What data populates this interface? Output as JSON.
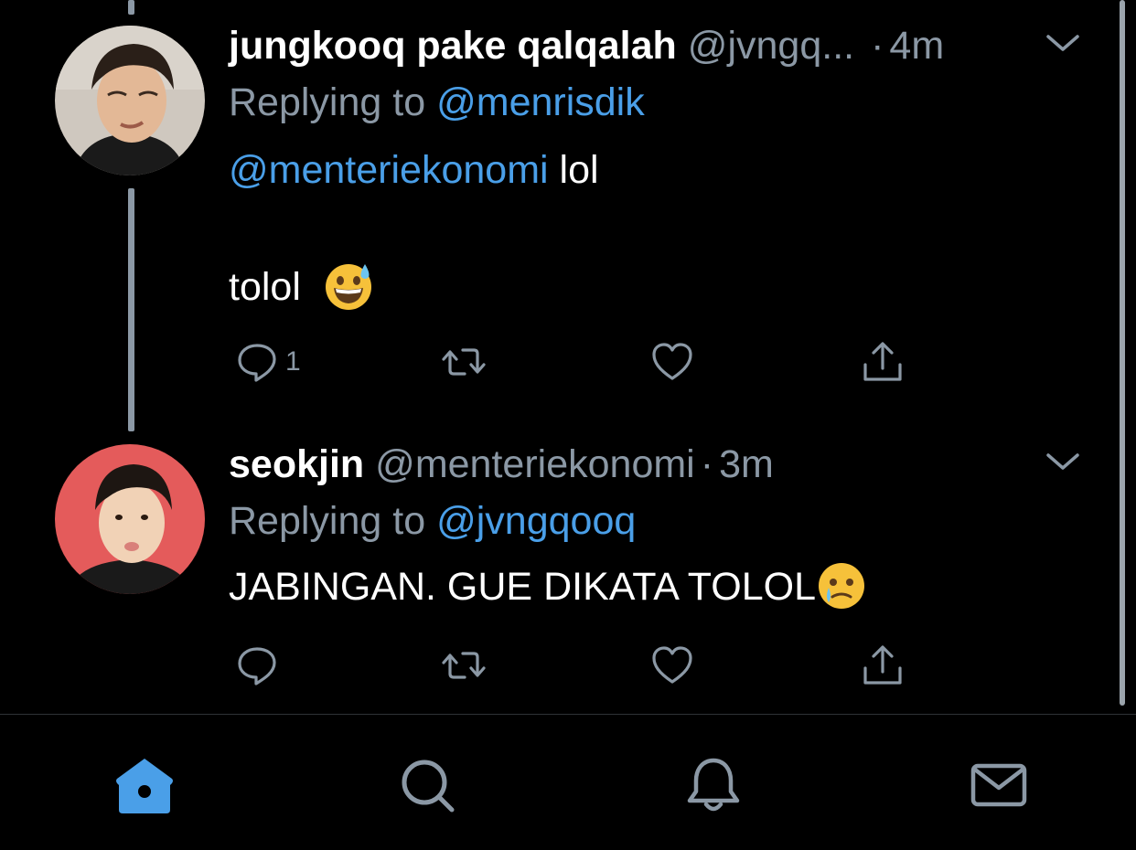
{
  "tweets": [
    {
      "display_name": "jungkooq pake qalqalah",
      "handle": "@jvngq...",
      "separator": "·",
      "time": "4m",
      "replying_prefix": "Replying to",
      "replying_to": "@menrisdik",
      "body_mention": "@menteriekonomi",
      "body_text_1": "lol",
      "body_text_2": "tolol",
      "body_emoji": "grinning-face-with-sweat",
      "reply_count": "1"
    },
    {
      "display_name": "seokjin",
      "handle": "@menteriekonomi",
      "separator": "·",
      "time": "3m",
      "replying_prefix": "Replying to",
      "replying_to": "@jvngqooq",
      "body_text": "JABINGAN. GUE DIKATA TOLOL",
      "body_emoji": "face-holding-back-tears",
      "reply_count": ""
    }
  ],
  "tabbar": {
    "items": [
      "home-icon",
      "search-icon",
      "notifications-icon",
      "messages-icon"
    ],
    "active": "home-icon"
  },
  "colors": {
    "background": "#000000",
    "accent": "#4a9fe8",
    "secondary_text": "#8b98a5",
    "divider": "#2f3336"
  }
}
